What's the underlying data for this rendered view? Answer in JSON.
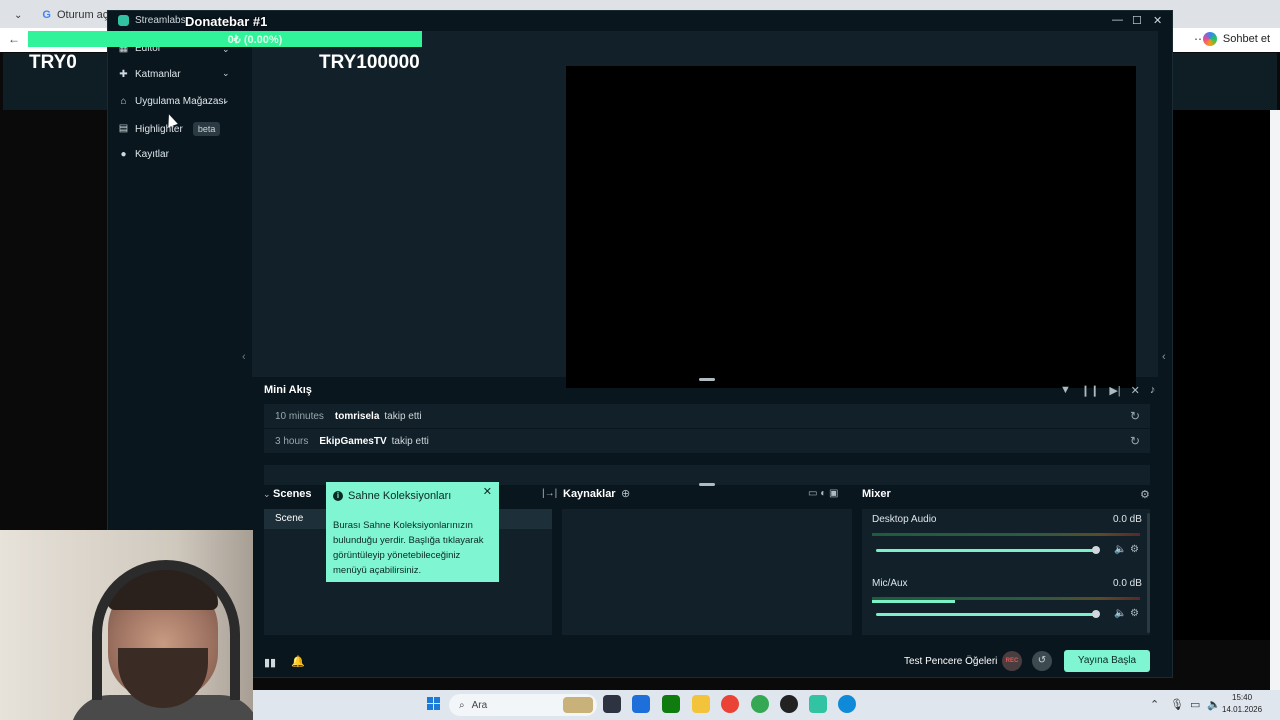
{
  "browser": {
    "tab_label": "Oturum açın - Go",
    "sohbet_label": "Sohbet et"
  },
  "overlay": {
    "donatebar_title": "Donatebar #1",
    "progress_text": "0₺ (0.00%)",
    "progress_fraction": 0.0,
    "current_amount": "TRY0",
    "goal_amount": "TRY100000"
  },
  "streamlabs": {
    "window_title": "Streamlabs",
    "nav": [
      {
        "label": "Editör",
        "icon": "editor-icon"
      },
      {
        "label": "Katmanlar",
        "icon": "layers-icon"
      },
      {
        "label": "Uygulama Mağazası",
        "icon": "store-icon"
      },
      {
        "label": "Highlighter",
        "icon": "highlighter-icon",
        "badge": "beta"
      },
      {
        "label": "Kayıtlar",
        "icon": "recordings-icon"
      }
    ],
    "mini_feed": {
      "title": "Mini Akış",
      "events": [
        {
          "time": "10 minutes",
          "user": "tomrisela",
          "action": "takip etti"
        },
        {
          "time": "3 hours",
          "user": "EkipGamesTV",
          "action": "takip etti"
        }
      ]
    },
    "scenes": {
      "title": "Scenes",
      "items": [
        "Scene"
      ]
    },
    "sources": {
      "title": "Kaynaklar"
    },
    "mixer": {
      "title": "Mixer",
      "channels": [
        {
          "name": "Desktop Audio",
          "db": "0.0 dB",
          "volume": 1.0
        },
        {
          "name": "Mic/Aux",
          "db": "0.0 dB",
          "volume": 1.0
        }
      ]
    },
    "tooltip": {
      "title": "Sahne Koleksiyonları",
      "body": "Burası Sahne Koleksiyonlarınızın bulunduğu yerdir. Başlığa tıklayarak görüntüleyip yönetebileceğiniz menüyü açabilirsiniz."
    },
    "footer": {
      "test_label": "Test Pencere Öğeleri",
      "rec_label": "REC",
      "go_live_label": "Yayına Başla"
    }
  },
  "taskbar": {
    "search_placeholder": "Ara",
    "time": "15:40",
    "date": "14.01.2026"
  },
  "colors": {
    "accent": "#80f5d2",
    "progress_green": "#31f39a",
    "app_bg": "#09161d",
    "panel_bg": "#112029"
  }
}
